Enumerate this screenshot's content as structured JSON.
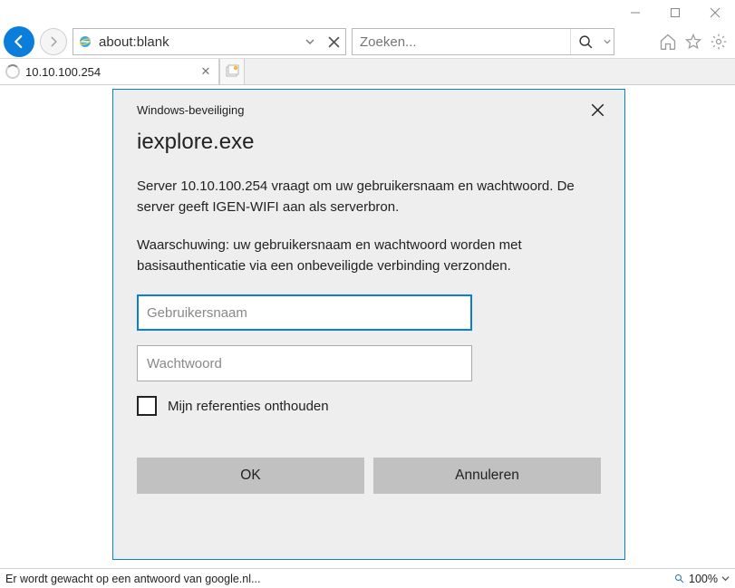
{
  "titlebar": {},
  "nav": {
    "address": "about:blank",
    "search_placeholder": "Zoeken..."
  },
  "tab": {
    "title": "10.10.100.254"
  },
  "dialog": {
    "title": "Windows-beveiliging",
    "heading": "iexplore.exe",
    "message1": "Server 10.10.100.254 vraagt om uw gebruikersnaam en wachtwoord. De server geeft IGEN-WIFI aan als serverbron.",
    "message2": "Waarschuwing: uw gebruikersnaam en wachtwoord worden met basisauthenticatie via een onbeveiligde verbinding verzonden.",
    "username_placeholder": "Gebruikersnaam",
    "password_placeholder": "Wachtwoord",
    "remember_label": "Mijn referenties onthouden",
    "ok_label": "OK",
    "cancel_label": "Annuleren"
  },
  "status": {
    "text": "Er wordt gewacht op een antwoord van google.nl...",
    "zoom": "100%"
  }
}
